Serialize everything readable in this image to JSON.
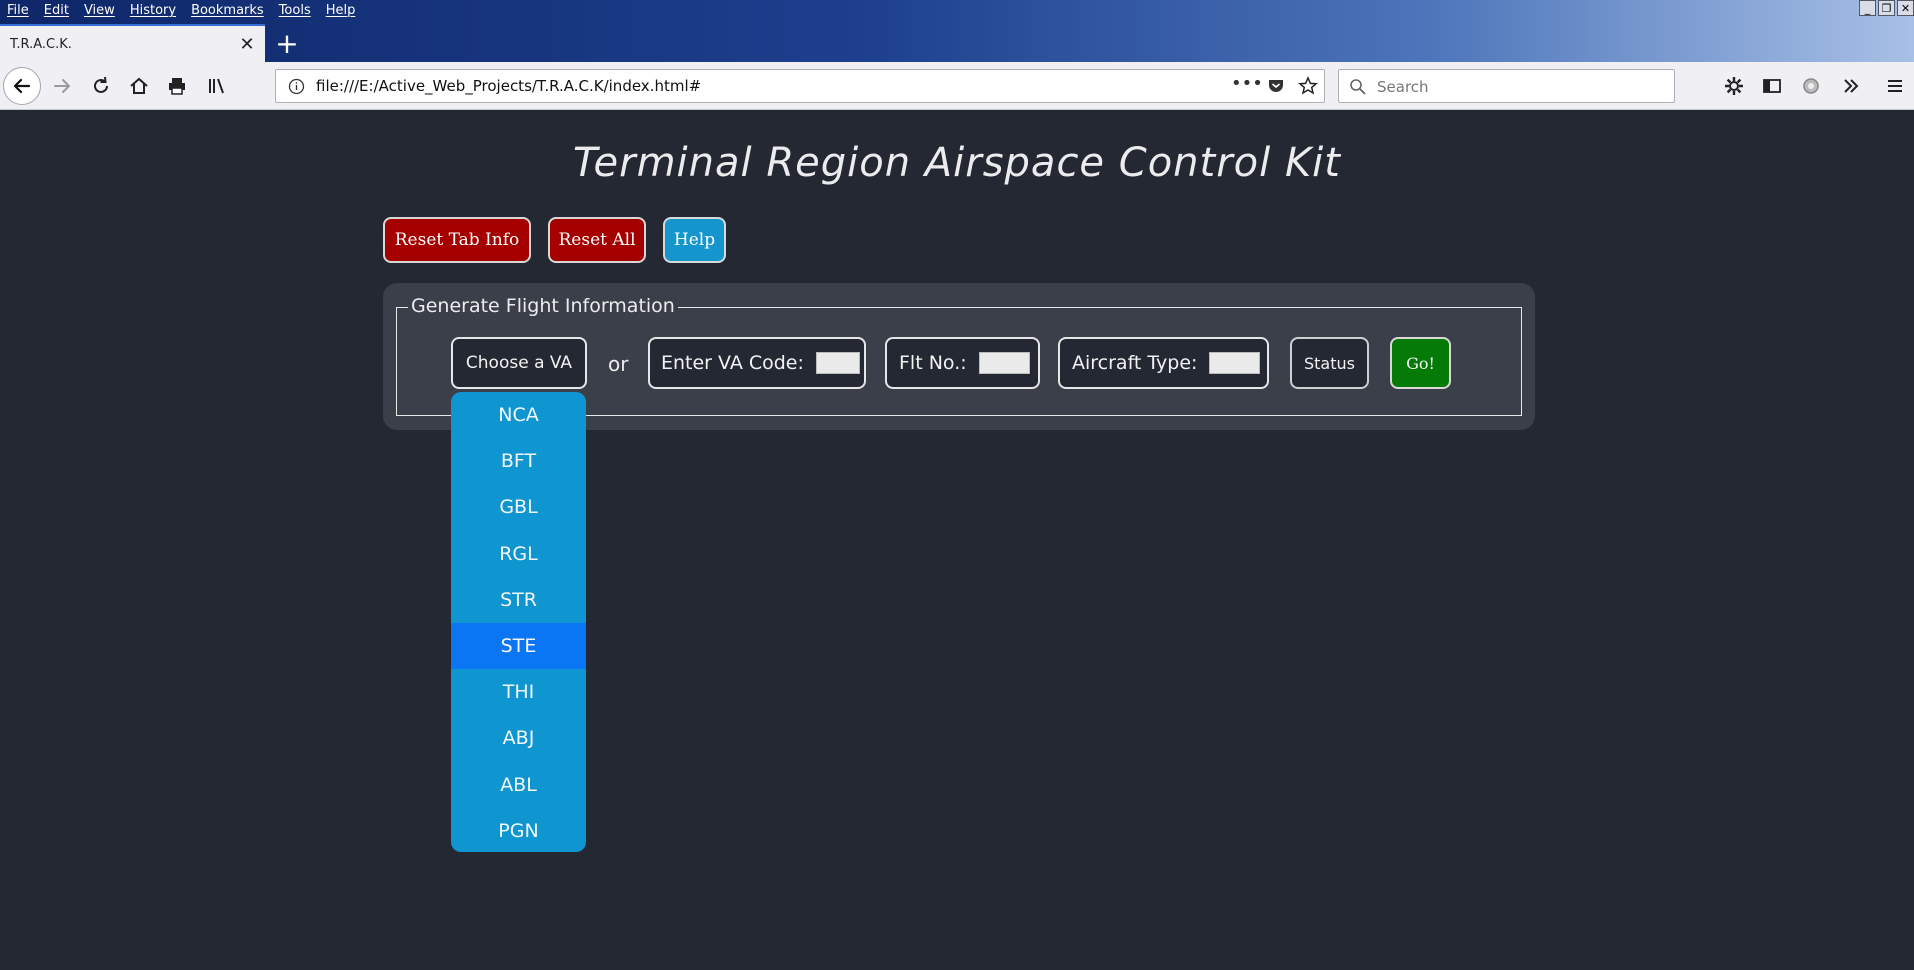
{
  "browser": {
    "menu": [
      "File",
      "Edit",
      "View",
      "History",
      "Bookmarks",
      "Tools",
      "Help"
    ],
    "tab_title": "T.R.A.C.K.",
    "url": "file:///E:/Active_Web_Projects/T.R.A.C.K/index.html#",
    "search_placeholder": "Search"
  },
  "page": {
    "title": "Terminal Region Airspace Control Kit",
    "buttons": {
      "reset_tab": "Reset Tab Info",
      "reset_all": "Reset All",
      "help": "Help"
    },
    "form": {
      "legend": "Generate Flight Information",
      "choose_va": "Choose a VA",
      "or": "or",
      "va_code_label": "Enter VA Code:",
      "flt_no_label": "Flt No.:",
      "aircraft_label": "Aircraft Type:",
      "status": "Status",
      "go": "Go!"
    },
    "dropdown": {
      "options": [
        "NCA",
        "BFT",
        "GBL",
        "RGL",
        "STR",
        "STE",
        "THI",
        "ABJ",
        "ABL",
        "PGN"
      ],
      "highlighted": "STE"
    }
  },
  "colors": {
    "page_bg": "#232833",
    "panel_bg": "#3b3f49",
    "danger": "#a50000",
    "info": "#1595cd",
    "success": "#067a06",
    "dropdown_bg": "#0f95d0",
    "dropdown_active": "#0a76f3"
  }
}
